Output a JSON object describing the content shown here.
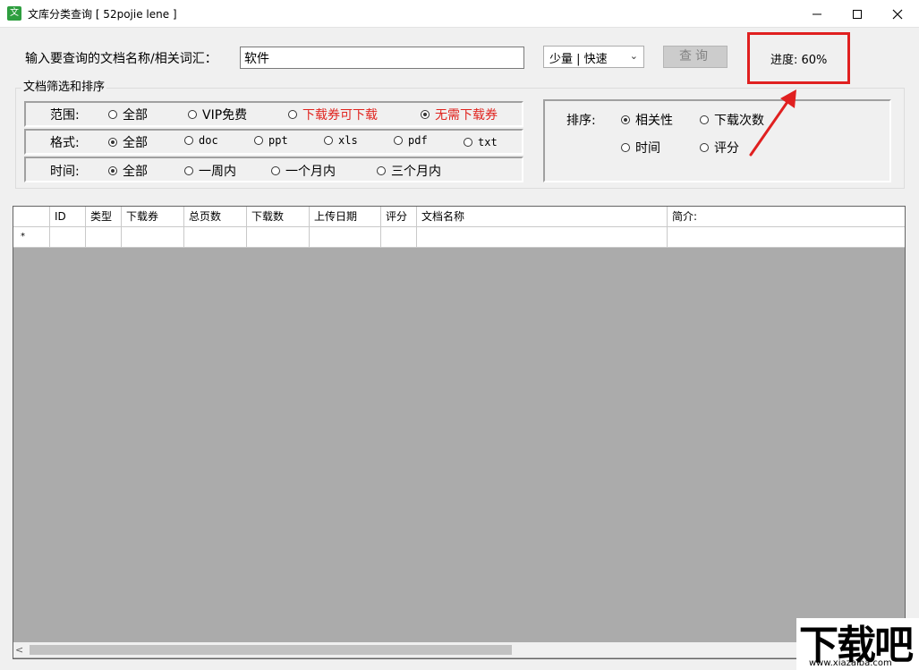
{
  "window": {
    "app_icon": "文",
    "title": "文库分类查询 [ 52pojie lene ]",
    "minimize_glyph": "—",
    "maximize_glyph": "☐",
    "close_glyph": "✕"
  },
  "search": {
    "label": "输入要查询的文档名称/相关词汇：",
    "value": "软件",
    "mode_value": "少量 | 快速",
    "query_label": "查询"
  },
  "progress": {
    "label": "进度: 60%",
    "value_percent": 60
  },
  "filters": {
    "legend": "文档筛选和排序",
    "scope": {
      "label": "范围:",
      "options": [
        "全部",
        "VIP免费",
        "下载券可下载",
        "无需下载券"
      ],
      "selected": "无需下载券"
    },
    "format": {
      "label": "格式:",
      "options": [
        "全部",
        "doc",
        "ppt",
        "xls",
        "pdf",
        "txt"
      ],
      "selected": "全部"
    },
    "time": {
      "label": "时间:",
      "options": [
        "全部",
        "一周内",
        "一个月内",
        "三个月内"
      ],
      "selected": "全部"
    }
  },
  "sort": {
    "label": "排序:",
    "options": [
      "相关性",
      "下载次数",
      "时间",
      "评分"
    ],
    "selected": "相关性"
  },
  "grid": {
    "columns": [
      "ID",
      "类型",
      "下载券",
      "总页数",
      "下载数",
      "上传日期",
      "评分",
      "文档名称",
      "简介:"
    ],
    "new_row_marker": "*",
    "scroll_left_glyph": "<"
  },
  "watermark": {
    "text": "下载吧",
    "url": "www.xiazaiba.com"
  },
  "colors": {
    "highlight_red": "#e02020",
    "red_option_text": "#e0241f",
    "grid_background": "#ababab"
  }
}
